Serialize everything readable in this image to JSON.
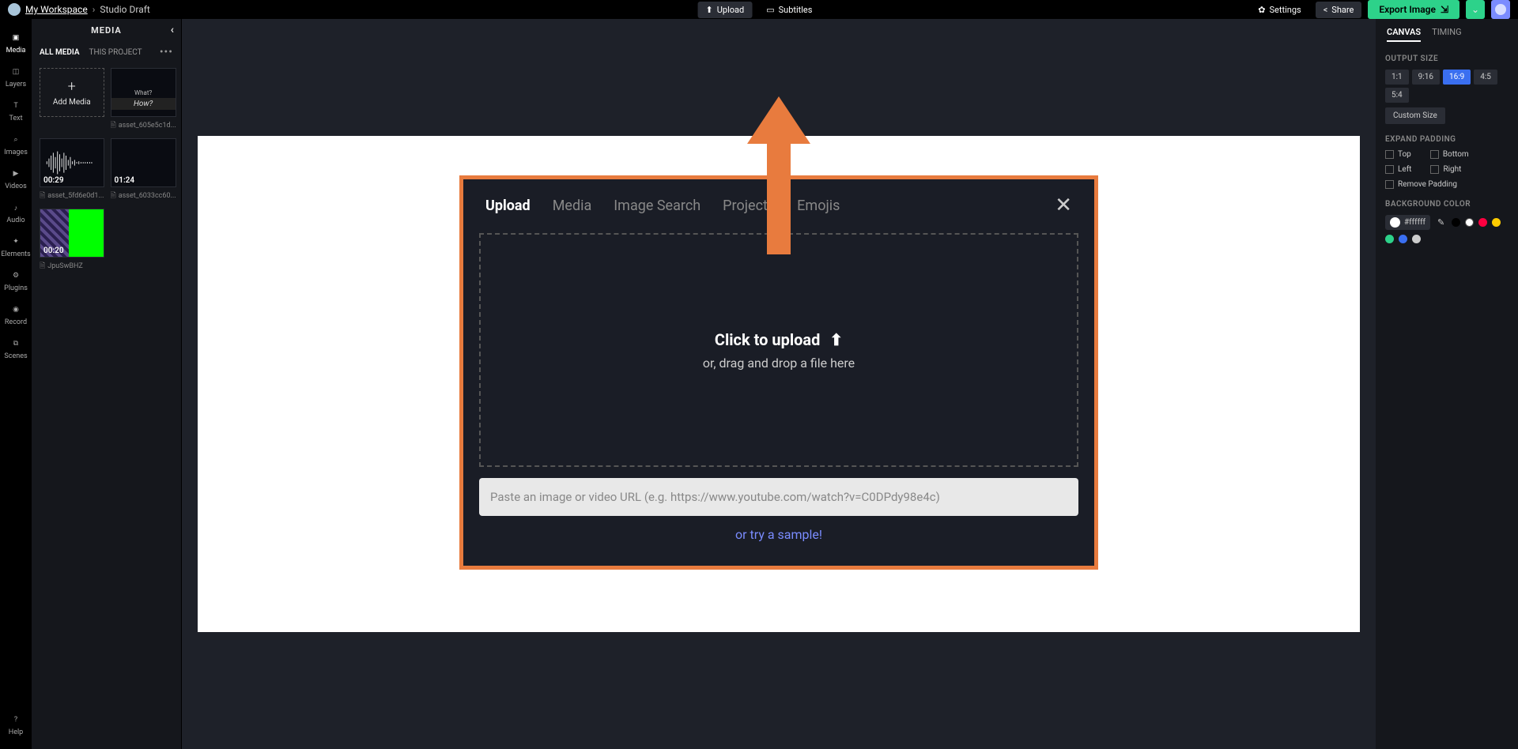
{
  "top": {
    "workspace": "My Workspace",
    "draft": "Studio Draft",
    "upload": "Upload",
    "subtitles": "Subtitles",
    "settings": "Settings",
    "share": "Share",
    "export": "Export Image"
  },
  "rail": {
    "media": "Media",
    "layers": "Layers",
    "text": "Text",
    "images": "Images",
    "videos": "Videos",
    "audio": "Audio",
    "elements": "Elements",
    "plugins": "Plugins",
    "record": "Record",
    "scenes": "Scenes",
    "help": "Help"
  },
  "media": {
    "title": "MEDIA",
    "tab_all": "ALL MEDIA",
    "tab_project": "THIS PROJECT",
    "add": "Add Media",
    "assets": [
      {
        "sub1": "What?",
        "sub2": "How?",
        "name": "asset_605e5c1d..."
      },
      {
        "time": "00:29",
        "name": "asset_5fd6e0d1..."
      },
      {
        "time": "01:24",
        "name": "asset_6033cc60..."
      },
      {
        "time": "00:20",
        "name": "JpuSwBHZ"
      }
    ]
  },
  "modal": {
    "tabs": {
      "upload": "Upload",
      "media": "Media",
      "image_search": "Image Search",
      "projects": "Projects",
      "emojis": "Emojis"
    },
    "drop_title": "Click to upload",
    "drop_sub": "or, drag and drop a file here",
    "url_placeholder": "Paste an image or video URL (e.g. https://www.youtube.com/watch?v=C0DPdy98e4c)",
    "sample": "or try a sample!"
  },
  "right": {
    "tab_canvas": "CANVAS",
    "tab_timing": "TIMING",
    "output_size": "OUTPUT SIZE",
    "ratios": [
      "1:1",
      "9:16",
      "16:9",
      "4:5",
      "5:4"
    ],
    "ratio_active": "16:9",
    "custom_size": "Custom Size",
    "expand_padding": "EXPAND PADDING",
    "pad_top": "Top",
    "pad_bottom": "Bottom",
    "pad_left": "Left",
    "pad_right": "Right",
    "remove_padding": "Remove Padding",
    "bg_color": "BACKGROUND COLOR",
    "hex": "#ffffff",
    "swatches": [
      "#000000",
      "#ffffff",
      "#ff0040",
      "#ffcc00",
      "#2dd28a",
      "#3a6ff0",
      "#cccccc"
    ]
  }
}
